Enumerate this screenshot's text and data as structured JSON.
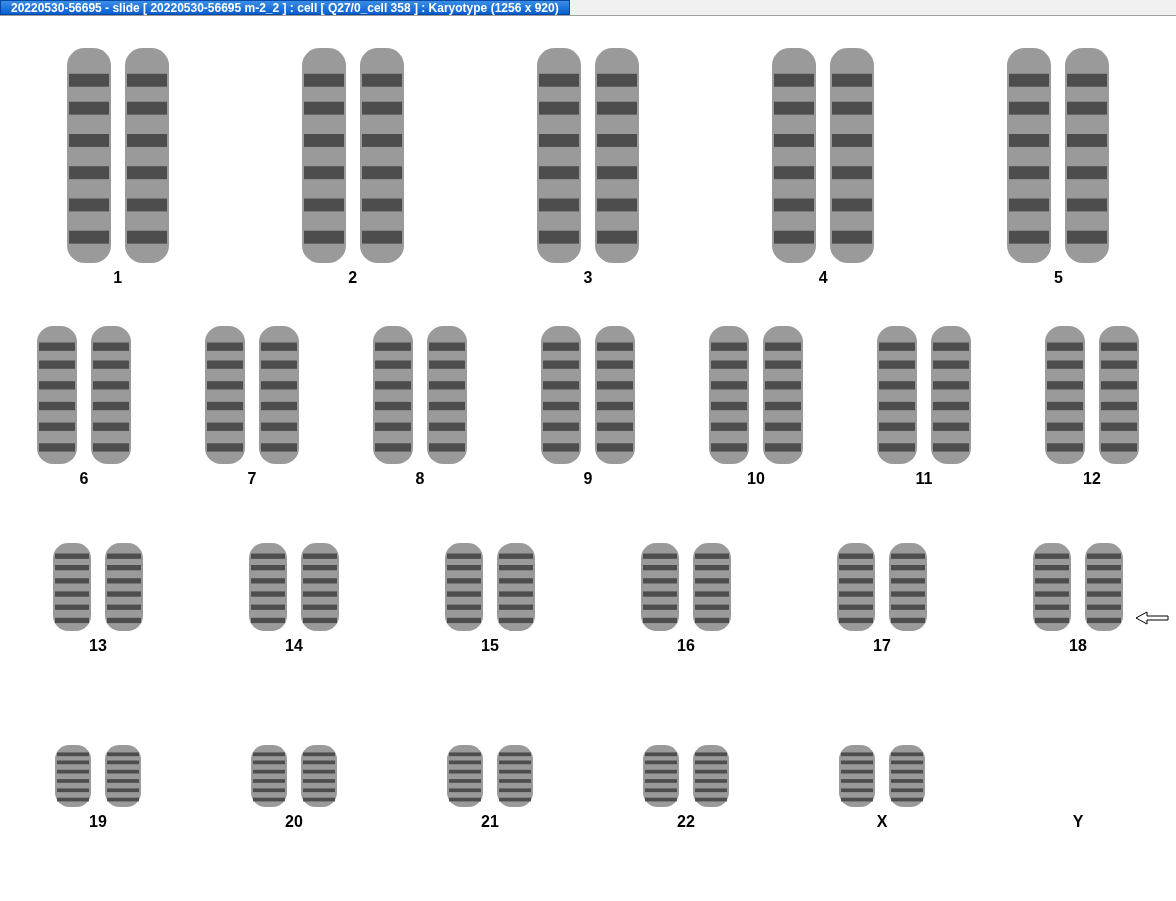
{
  "window": {
    "title": "20220530-56695 - slide [ 20220530-56695 m-2_2 ] : cell [ Q27/0_cell 358 ] : Karyotype  (1256 x 920)"
  },
  "rows": [
    [
      {
        "label": "1",
        "kind": "pair",
        "marked": false
      },
      {
        "label": "2",
        "kind": "pair",
        "marked": false
      },
      {
        "label": "3",
        "kind": "pair",
        "marked": false
      },
      {
        "label": "4",
        "kind": "pair",
        "marked": false
      },
      {
        "label": "5",
        "kind": "pair",
        "marked": false
      }
    ],
    [
      {
        "label": "6",
        "kind": "pair",
        "marked": false
      },
      {
        "label": "7",
        "kind": "pair",
        "marked": false
      },
      {
        "label": "8",
        "kind": "pair",
        "marked": false
      },
      {
        "label": "9",
        "kind": "pair",
        "marked": false
      },
      {
        "label": "10",
        "kind": "pair",
        "marked": false
      },
      {
        "label": "11",
        "kind": "pair",
        "marked": false
      },
      {
        "label": "12",
        "kind": "pair",
        "marked": false
      }
    ],
    [
      {
        "label": "13",
        "kind": "pair",
        "marked": false
      },
      {
        "label": "14",
        "kind": "pair",
        "marked": false
      },
      {
        "label": "15",
        "kind": "pair",
        "marked": false
      },
      {
        "label": "16",
        "kind": "pair",
        "marked": false
      },
      {
        "label": "17",
        "kind": "pair",
        "marked": false
      },
      {
        "label": "18",
        "kind": "pair",
        "marked": true
      }
    ],
    [
      {
        "label": "19",
        "kind": "pair",
        "marked": false
      },
      {
        "label": "20",
        "kind": "pair",
        "marked": false
      },
      {
        "label": "21",
        "kind": "pair",
        "marked": false
      },
      {
        "label": "22",
        "kind": "pair",
        "marked": false
      },
      {
        "label": "X",
        "kind": "pair",
        "marked": false
      },
      {
        "label": "Y",
        "kind": "empty",
        "marked": false
      }
    ]
  ]
}
